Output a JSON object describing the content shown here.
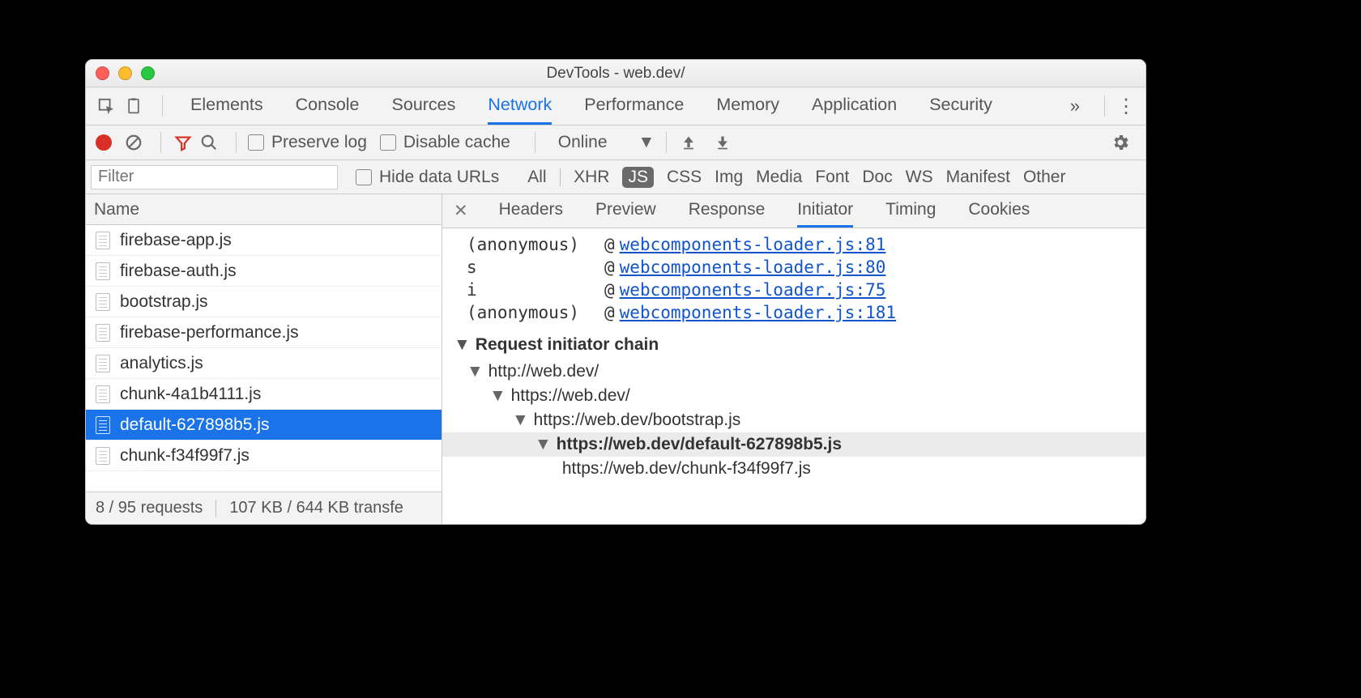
{
  "window": {
    "title": "DevTools - web.dev/"
  },
  "tabs": [
    "Elements",
    "Console",
    "Sources",
    "Network",
    "Performance",
    "Memory",
    "Application",
    "Security"
  ],
  "active_tab": "Network",
  "toolbar": {
    "preserve_log": "Preserve log",
    "disable_cache": "Disable cache",
    "throttle": "Online"
  },
  "filter": {
    "placeholder": "Filter",
    "hide_data_urls": "Hide data URLs",
    "types": [
      "All",
      "XHR",
      "JS",
      "CSS",
      "Img",
      "Media",
      "Font",
      "Doc",
      "WS",
      "Manifest",
      "Other"
    ],
    "active_type": "JS"
  },
  "name_column": {
    "header": "Name"
  },
  "requests": [
    {
      "name": "firebase-app.js"
    },
    {
      "name": "firebase-auth.js"
    },
    {
      "name": "bootstrap.js"
    },
    {
      "name": "firebase-performance.js"
    },
    {
      "name": "analytics.js"
    },
    {
      "name": "chunk-4a1b4111.js"
    },
    {
      "name": "default-627898b5.js",
      "selected": true
    },
    {
      "name": "chunk-f34f99f7.js"
    }
  ],
  "status": {
    "requests": "8 / 95 requests",
    "transfer": "107 KB / 644 KB transfe"
  },
  "detail_tabs": [
    "Headers",
    "Preview",
    "Response",
    "Initiator",
    "Timing",
    "Cookies"
  ],
  "active_detail_tab": "Initiator",
  "stack": [
    {
      "fn": "(anonymous)",
      "link": "webcomponents-loader.js:81"
    },
    {
      "fn": "s",
      "link": "webcomponents-loader.js:80"
    },
    {
      "fn": "i",
      "link": "webcomponents-loader.js:75"
    },
    {
      "fn": "(anonymous)",
      "link": "webcomponents-loader.js:181"
    }
  ],
  "chain_heading": "Request initiator chain",
  "chain": [
    {
      "url": "http://web.dev/",
      "indent": 0,
      "expand": true
    },
    {
      "url": "https://web.dev/",
      "indent": 1,
      "expand": true
    },
    {
      "url": "https://web.dev/bootstrap.js",
      "indent": 2,
      "expand": true
    },
    {
      "url": "https://web.dev/default-627898b5.js",
      "indent": 3,
      "expand": true,
      "highlight": true
    },
    {
      "url": "https://web.dev/chunk-f34f99f7.js",
      "indent": 4
    }
  ]
}
